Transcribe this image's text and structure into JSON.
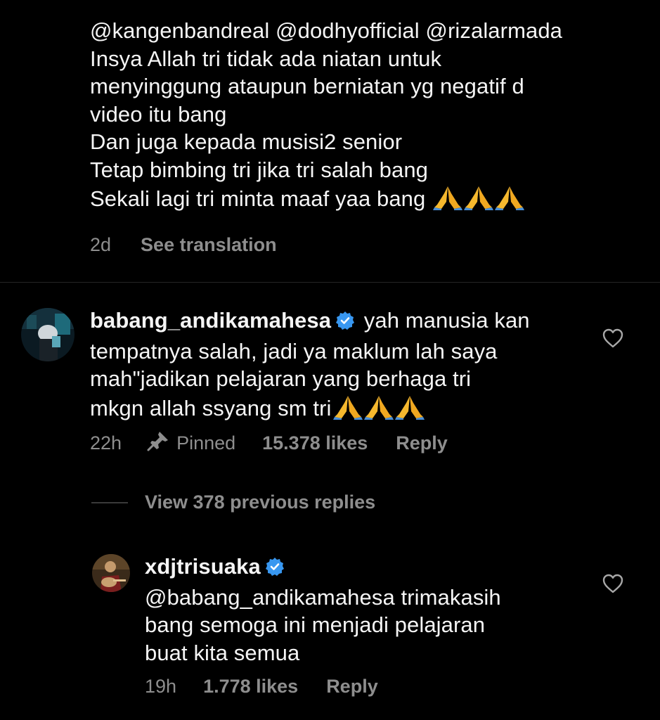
{
  "colors": {
    "background": "#000000",
    "text": "#f5f5f5",
    "muted": "#8e8e8e",
    "verified": "#3897f0",
    "emoji_hands": "#f5b82e"
  },
  "top_comment": {
    "lines": [
      "@kangenbandreal @dodhyofficial @rizalarmada",
      "Insya Allah tri tidak ada niatan untuk",
      "menyinggung ataupun berniatan yg negatif d",
      "video itu bang",
      "Dan juga kepada musisi2 senior",
      "Tetap bimbing tri jika tri salah bang",
      "Sekali lagi tri minta maaf yaa bang"
    ],
    "time": "2d",
    "see_translation": "See translation"
  },
  "pinned_comment": {
    "username": "babang_andikamahesa",
    "first_line": "yah manusia kan",
    "lines": [
      "tempatnya salah, jadi ya maklum lah saya",
      "mah\"jadikan pelajaran yang berhaga tri",
      "mkgn allah ssyang sm tri"
    ],
    "time": "22h",
    "pinned_label": "Pinned",
    "likes": "15.378 likes",
    "reply": "Reply"
  },
  "view_replies": "View 378 previous replies",
  "reply_comment": {
    "username": "xdjtrisuaka",
    "lines": [
      "@babang_andikamahesa trimakasih",
      "bang semoga ini menjadi pelajaran",
      "buat kita semua"
    ],
    "time": "19h",
    "likes": "1.778 likes",
    "reply": "Reply"
  },
  "icons": {
    "heart": "heart-outline-icon",
    "pin": "pushpin-icon",
    "verified": "verified-badge-icon",
    "emoji": "folded-hands-emoji"
  }
}
